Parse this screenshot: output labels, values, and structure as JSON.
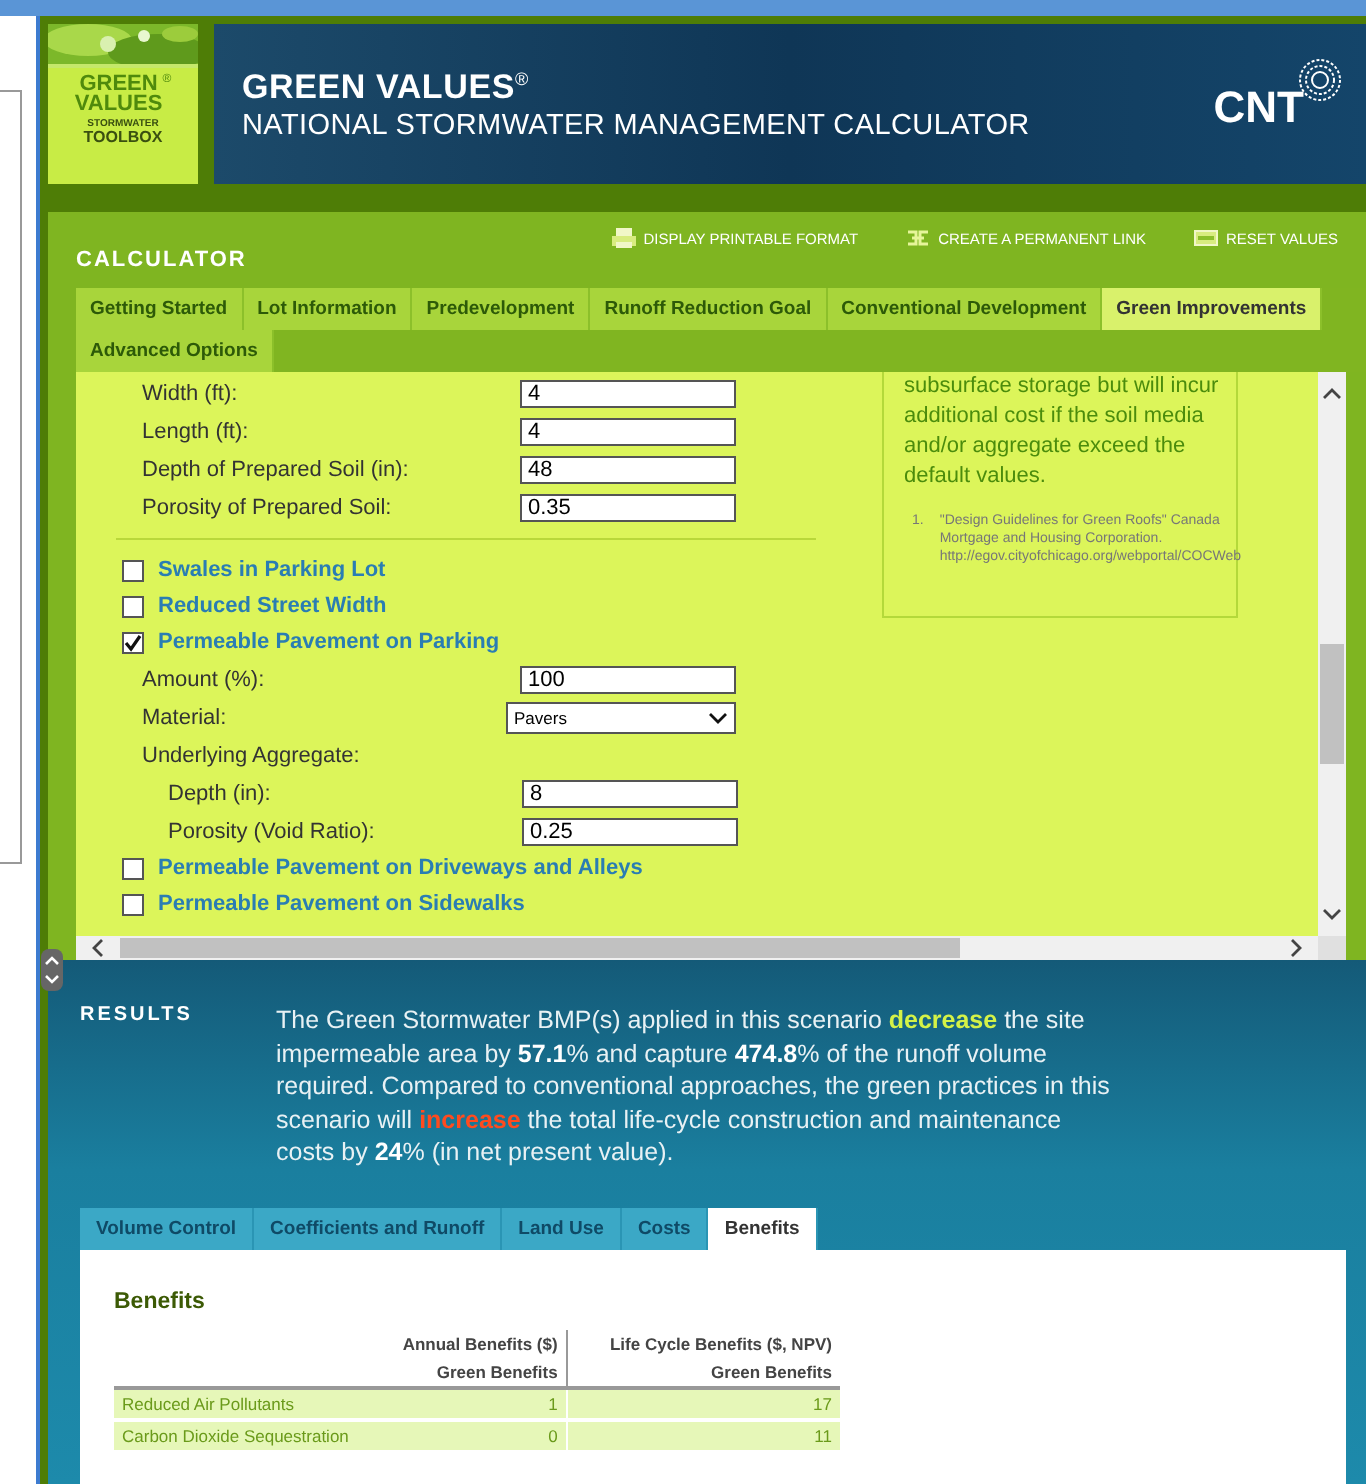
{
  "logo": {
    "line1": "GREEN",
    "line2": "VALUES",
    "mark": "®",
    "line3": "STORMWATER",
    "line4": "TOOLBOX"
  },
  "banner": {
    "title": "GREEN VALUES",
    "title_mark": "®",
    "subtitle": "NATIONAL STORMWATER MANAGEMENT CALCULATOR",
    "brand": "CNT"
  },
  "calculator": {
    "title": "CALCULATOR",
    "actions": [
      {
        "kind": "print",
        "label": "DISPLAY PRINTABLE FORMAT"
      },
      {
        "kind": "link",
        "label": "CREATE A PERMANENT LINK"
      },
      {
        "kind": "reset",
        "label": "RESET VALUES"
      }
    ],
    "tabs": [
      {
        "label": "Getting Started",
        "selected": false
      },
      {
        "label": "Lot Information",
        "selected": false
      },
      {
        "label": "Predevelopment",
        "selected": false
      },
      {
        "label": "Runoff Reduction Goal",
        "selected": false
      },
      {
        "label": "Conventional Development",
        "selected": false
      },
      {
        "label": "Green Improvements",
        "selected": true
      },
      {
        "label": "Advanced Options",
        "selected": false
      }
    ],
    "form": [
      {
        "kind": "fields",
        "children": [
          {
            "kind": "input",
            "label": "Width (ft):",
            "value": "4"
          },
          {
            "kind": "input",
            "label": "Length (ft):",
            "value": "4"
          },
          {
            "kind": "input",
            "label": "Depth of Prepared Soil (in):",
            "value": "48"
          },
          {
            "kind": "input",
            "label": "Porosity of Prepared Soil:",
            "value": "0.35"
          }
        ]
      },
      {
        "kind": "checkbox",
        "label": "Swales in Parking Lot",
        "checked": false
      },
      {
        "kind": "checkbox",
        "label": "Reduced Street Width",
        "checked": false
      },
      {
        "kind": "checkbox",
        "label": "Permeable Pavement on Parking",
        "checked": true,
        "children": [
          {
            "kind": "input",
            "label": "Amount (%):",
            "value": "100"
          },
          {
            "kind": "select",
            "label": "Material:",
            "value": "Pavers"
          },
          {
            "kind": "heading",
            "label": "Underlying Aggregate:",
            "children": [
              {
                "kind": "input",
                "label": "Depth (in):",
                "value": "8"
              },
              {
                "kind": "input",
                "label": "Porosity (Void Ratio):",
                "value": "0.25"
              }
            ]
          }
        ]
      },
      {
        "kind": "checkbox",
        "label": "Permeable Pavement on Driveways and Alleys",
        "checked": false
      },
      {
        "kind": "checkbox",
        "label": "Permeable Pavement on Sidewalks",
        "checked": false
      }
    ],
    "note": {
      "text": "subsurface storage but will incur additional cost if the soil media and/or aggregate exceed the default values.",
      "footnotes": [
        {
          "number": "1.",
          "text": "\"Design Guidelines for Green Roofs\" Canada Mortgage and Housing Corporation.",
          "url": "http://egov.cityofchicago.org/webportal/COCWeb"
        }
      ]
    }
  },
  "results": {
    "title": "RESULTS",
    "summary": "The Green Stormwater BMP(s) applied in this scenario **decrease** the site impermeable area by **57.1**% and capture **474.8**% of the runoff volume required. Compared to conventional approaches, the green practices in this scenario will *increase* the total life-cycle construction and maintenance costs by **24**% (in net present value).",
    "tabs": [
      {
        "label": "Volume Control",
        "selected": false
      },
      {
        "label": "Coefficients and Runoff",
        "selected": false
      },
      {
        "label": "Land Use",
        "selected": false
      },
      {
        "label": "Costs",
        "selected": false
      },
      {
        "label": "Benefits",
        "selected": true
      }
    ],
    "panel_title": "Benefits",
    "table": {
      "columns": [
        "",
        "Annual Benefits ($)",
        "Life Cycle Benefits ($, NPV)"
      ],
      "subcolumns": [
        "",
        "Green Benefits",
        "Green Benefits"
      ],
      "rows": [
        [
          "Reduced Air Pollutants",
          "1",
          "17"
        ],
        [
          "Carbon Dioxide Sequestration",
          "0",
          "11"
        ]
      ]
    }
  }
}
